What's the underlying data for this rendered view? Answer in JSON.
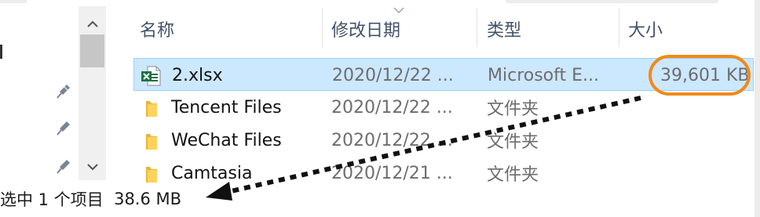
{
  "columns": {
    "name": "名称",
    "date_modified": "修改日期",
    "type": "类型",
    "size": "大小"
  },
  "files": [
    {
      "name": "2.xlsx",
      "date": "2020/12/22 ...",
      "type": "Microsoft E...",
      "size": "39,601 KB",
      "icon": "excel-file-icon",
      "selected": true
    },
    {
      "name": "Tencent Files",
      "date": "2020/12/22 ...",
      "type": "文件夹",
      "size": "",
      "icon": "folder-icon",
      "selected": false
    },
    {
      "name": "WeChat Files",
      "date": "2020/12/22 ...",
      "type": "文件夹",
      "size": "",
      "icon": "folder-icon",
      "selected": false
    },
    {
      "name": "Camtasia",
      "date": "2020/12/21 ...",
      "type": "文件夹",
      "size": "",
      "icon": "folder-icon",
      "selected": false
    }
  ],
  "status_bar": {
    "selection": "选中 1 个项目",
    "selected_size": "38.6 MB"
  },
  "colors": {
    "selection_fill": "#cce8ff",
    "highlight_oval": "#f08a1a",
    "header_text": "#43526a"
  }
}
